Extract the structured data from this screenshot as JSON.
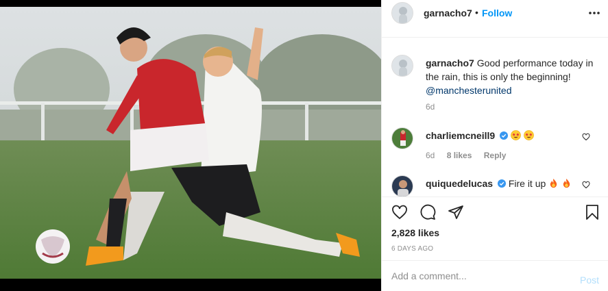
{
  "post": {
    "author": "garnacho7",
    "follow_label": "Follow",
    "dot": "•"
  },
  "caption": {
    "username": "garnacho7",
    "text": "Good performance today in the rain, this is only the beginning!",
    "mention": "@manchesterunited",
    "time": "6d"
  },
  "comments": [
    {
      "username": "charliemcneill9",
      "text": "",
      "emojis": [
        "star-struck-icon",
        "star-struck-icon"
      ],
      "time": "6d",
      "likes": "8 likes",
      "reply": "Reply"
    },
    {
      "username": "quiquedelucas",
      "text": "Fire it up",
      "emojis": [
        "fire-icon",
        "fire-icon"
      ]
    }
  ],
  "stats": {
    "likes": "2,828 likes",
    "date": "6 DAYS AGO"
  },
  "composer": {
    "placeholder": "Add a comment...",
    "post_label": "Post"
  },
  "colors": {
    "accent": "#0095f6",
    "verified": "#3897f0",
    "muted": "#8e8e8e",
    "post_disabled": "#b2dffc"
  }
}
